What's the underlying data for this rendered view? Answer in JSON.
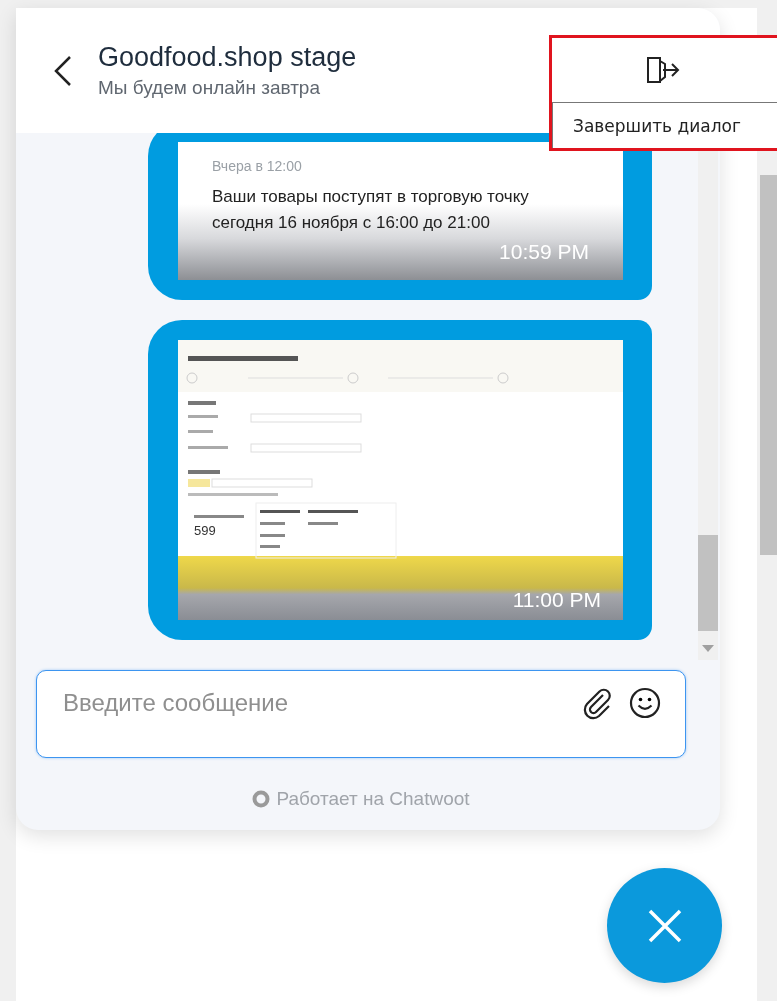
{
  "header": {
    "title": "Goodfood.shop stage",
    "subtitle": "Мы будем онлайн завтра"
  },
  "end_chat": {
    "tooltip": "Завершить диалог"
  },
  "messages": [
    {
      "kind": "card",
      "date": "Вчера в 12:00",
      "text": "Ваши товары поступят в торговую точку сегодня 16 ноября с 16:00 до 21:00",
      "time": "10:59 PM"
    },
    {
      "kind": "image",
      "figure": "599",
      "time": "11:00 PM"
    }
  ],
  "composer": {
    "placeholder": "Введите сообщение"
  },
  "branding": "Работает на Chatwoot"
}
